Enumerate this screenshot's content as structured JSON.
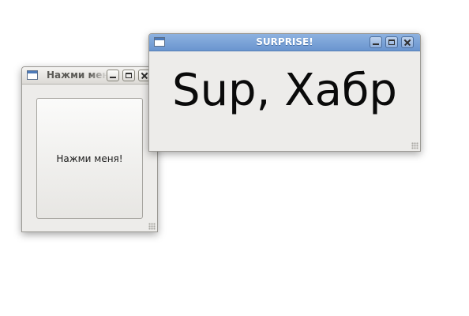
{
  "windows": [
    {
      "title": "Нажми меня!",
      "button_label": "Нажми меня!",
      "controls": [
        "minimize-icon",
        "maximize-icon",
        "close-icon"
      ]
    },
    {
      "title": "SURPRISE!",
      "label_text": "Sup, Хабр",
      "controls": [
        "minimize-icon",
        "maximize-icon",
        "close-icon"
      ]
    }
  ],
  "colors": {
    "active_titlebar": "#6a95cf",
    "inactive_titlebar": "#dcdad6",
    "window_background": "#edecea",
    "desktop": "#ffffff"
  }
}
